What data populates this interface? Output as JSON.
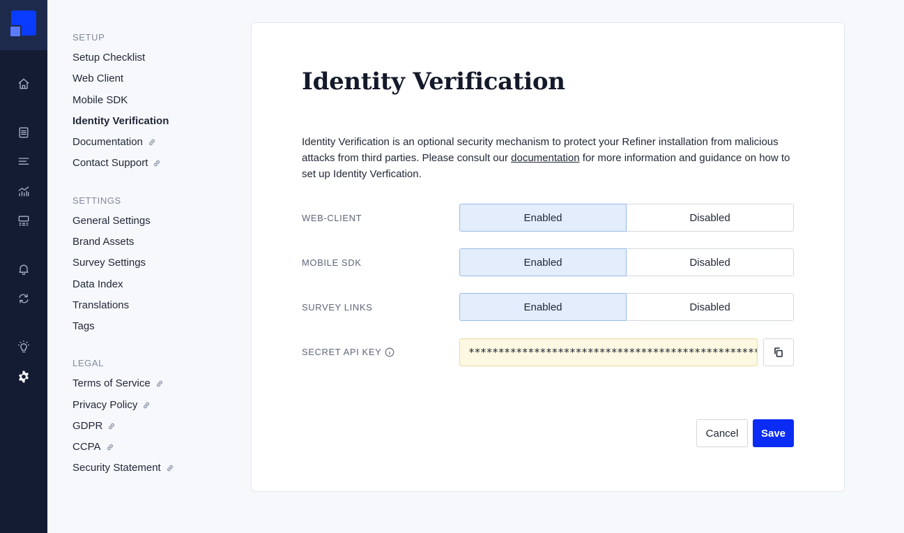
{
  "rail": {
    "icons": [
      "home-icon",
      "list-icon",
      "menu-icon",
      "analytics-icon",
      "segments-icon",
      "bell-icon",
      "sync-icon",
      "lightbulb-icon",
      "gear-icon"
    ]
  },
  "nav": {
    "setup_heading": "SETUP",
    "setup_items": [
      "Setup Checklist",
      "Web Client",
      "Mobile SDK",
      "Identity Verification",
      "Documentation",
      "Contact Support"
    ],
    "settings_heading": "SETTINGS",
    "settings_items": [
      "General Settings",
      "Brand Assets",
      "Survey Settings",
      "Data Index",
      "Translations",
      "Tags"
    ],
    "legal_heading": "LEGAL",
    "legal_items": [
      "Terms of Service",
      "Privacy Policy",
      "GDPR",
      "CCPA",
      "Security Statement"
    ]
  },
  "page": {
    "title": "Identity Verification",
    "desc_before": "Identity Verification is an optional security mechanism to protect your Refiner installation from malicious attacks from third parties. Please consult our ",
    "desc_link": "documentation",
    "desc_after": " for more information and guidance on how to set up Identity Verfication.",
    "rows": [
      {
        "label": "WEB-CLIENT",
        "enabled": "Enabled",
        "disabled": "Disabled",
        "selected": "Enabled"
      },
      {
        "label": "MOBILE SDK",
        "enabled": "Enabled",
        "disabled": "Disabled",
        "selected": "Enabled"
      },
      {
        "label": "SURVEY LINKS",
        "enabled": "Enabled",
        "disabled": "Disabled",
        "selected": "Enabled"
      }
    ],
    "secret_label": "SECRET API KEY",
    "secret_value": "**************************************************",
    "cancel_label": "Cancel",
    "save_label": "Save"
  },
  "colors": {
    "rail_bg": "#141c33",
    "brand": "#0a3cff",
    "save_button": "#0a2cf5",
    "toggle_selected": "#e3edfb",
    "key_field_bg": "#fdf8e1"
  }
}
